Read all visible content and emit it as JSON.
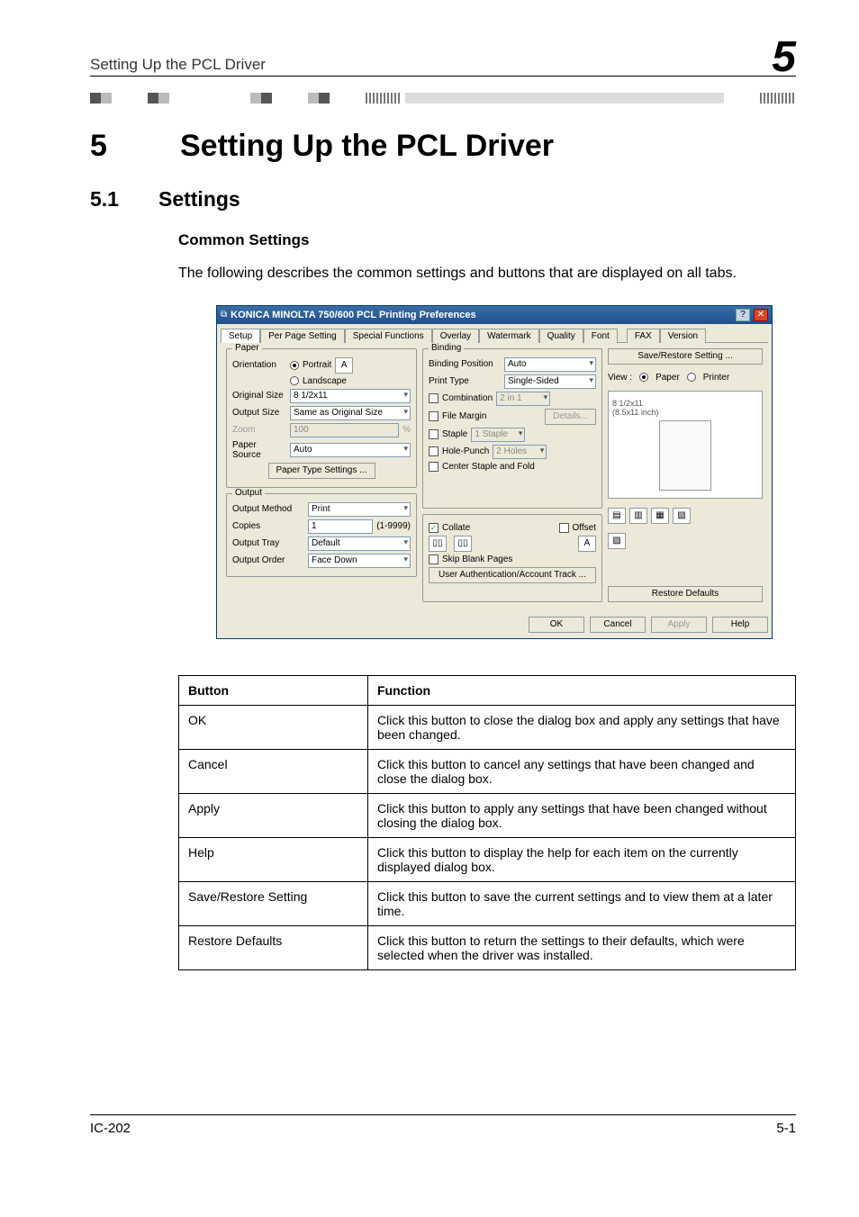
{
  "header": {
    "running_title": "Setting Up the PCL Driver",
    "chapter_big": "5"
  },
  "chapter": {
    "number": "5",
    "title": "Setting Up the PCL Driver"
  },
  "section": {
    "number": "5.1",
    "title": "Settings"
  },
  "subsection": {
    "title": "Common Settings",
    "body": "The following describes the common settings and buttons that are displayed on all tabs."
  },
  "dialog": {
    "title": "KONICA MINOLTA 750/600 PCL Printing Preferences",
    "tabs": [
      "Setup",
      "Per Page Setting",
      "Special Functions",
      "Overlay",
      "Watermark",
      "Quality",
      "Font",
      "FAX",
      "Version"
    ],
    "active_tab": "Setup",
    "paper": {
      "group": "Paper",
      "orientation_label": "Orientation",
      "portrait": "Portrait",
      "landscape": "Landscape",
      "original_size_label": "Original Size",
      "original_size": "8 1/2x11",
      "output_size_label": "Output Size",
      "output_size": "Same as Original Size",
      "zoom_label": "Zoom",
      "zoom_value": "100",
      "zoom_suffix": "%",
      "paper_source_label": "Paper Source",
      "paper_source": "Auto",
      "paper_type_btn": "Paper Type Settings ..."
    },
    "binding": {
      "group": "Binding",
      "position_label": "Binding Position",
      "position": "Auto",
      "print_type_label": "Print Type",
      "print_type": "Single-Sided",
      "combination_label": "Combination",
      "combination_value": "2 in 1",
      "file_margin_label": "File Margin",
      "details_btn": "Details...",
      "staple_label": "Staple",
      "staple_value": "1 Staple",
      "hole_label": "Hole-Punch",
      "hole_value": "2 Holes",
      "center_label": "Center Staple and Fold"
    },
    "output": {
      "group": "Output",
      "method_label": "Output Method",
      "method": "Print",
      "copies_label": "Copies",
      "copies": "1",
      "copies_range": "(1-9999)",
      "tray_label": "Output Tray",
      "tray": "Default",
      "order_label": "Output Order",
      "order": "Face Down",
      "collate_label": "Collate",
      "offset_label": "Offset",
      "skip_blank_label": "Skip Blank Pages",
      "auth_btn": "User Authentication/Account Track ..."
    },
    "right": {
      "save_btn": "Save/Restore Setting ...",
      "view_label": "View :",
      "paper_radio": "Paper",
      "printer_radio": "Printer",
      "size_line1": "8 1/2x11",
      "size_line2": "(8.5x11 inch)",
      "restore_btn": "Restore Defaults"
    },
    "footer": {
      "ok": "OK",
      "cancel": "Cancel",
      "apply": "Apply",
      "help": "Help"
    }
  },
  "table": {
    "headers": [
      "Button",
      "Function"
    ],
    "rows": [
      {
        "button": "OK",
        "func": "Click this button to close the dialog box and apply any settings that have been changed."
      },
      {
        "button": "Cancel",
        "func": "Click this button to cancel any settings that have been changed and close the dialog box."
      },
      {
        "button": "Apply",
        "func": "Click this button to apply any settings that have been changed without closing the dialog box."
      },
      {
        "button": "Help",
        "func": "Click this button to display the help for each item on the currently displayed dialog box."
      },
      {
        "button": "Save/Restore Setting",
        "func": "Click this button to save the current settings and to view them at a later time."
      },
      {
        "button": "Restore Defaults",
        "func": "Click this button to return the settings to their defaults, which were selected when the driver was installed."
      }
    ]
  },
  "page_footer": {
    "left": "IC-202",
    "right": "5-1"
  },
  "chart_data": {
    "type": "table",
    "title": "Common Settings — Button Functions",
    "columns": [
      "Button",
      "Function"
    ],
    "rows": [
      [
        "OK",
        "Click this button to close the dialog box and apply any settings that have been changed."
      ],
      [
        "Cancel",
        "Click this button to cancel any settings that have been changed and close the dialog box."
      ],
      [
        "Apply",
        "Click this button to apply any settings that have been changed without closing the dialog box."
      ],
      [
        "Help",
        "Click this button to display the help for each item on the currently displayed dialog box."
      ],
      [
        "Save/Restore Setting",
        "Click this button to save the current settings and to view them at a later time."
      ],
      [
        "Restore Defaults",
        "Click this button to return the settings to their defaults, which were selected when the driver was installed."
      ]
    ]
  }
}
